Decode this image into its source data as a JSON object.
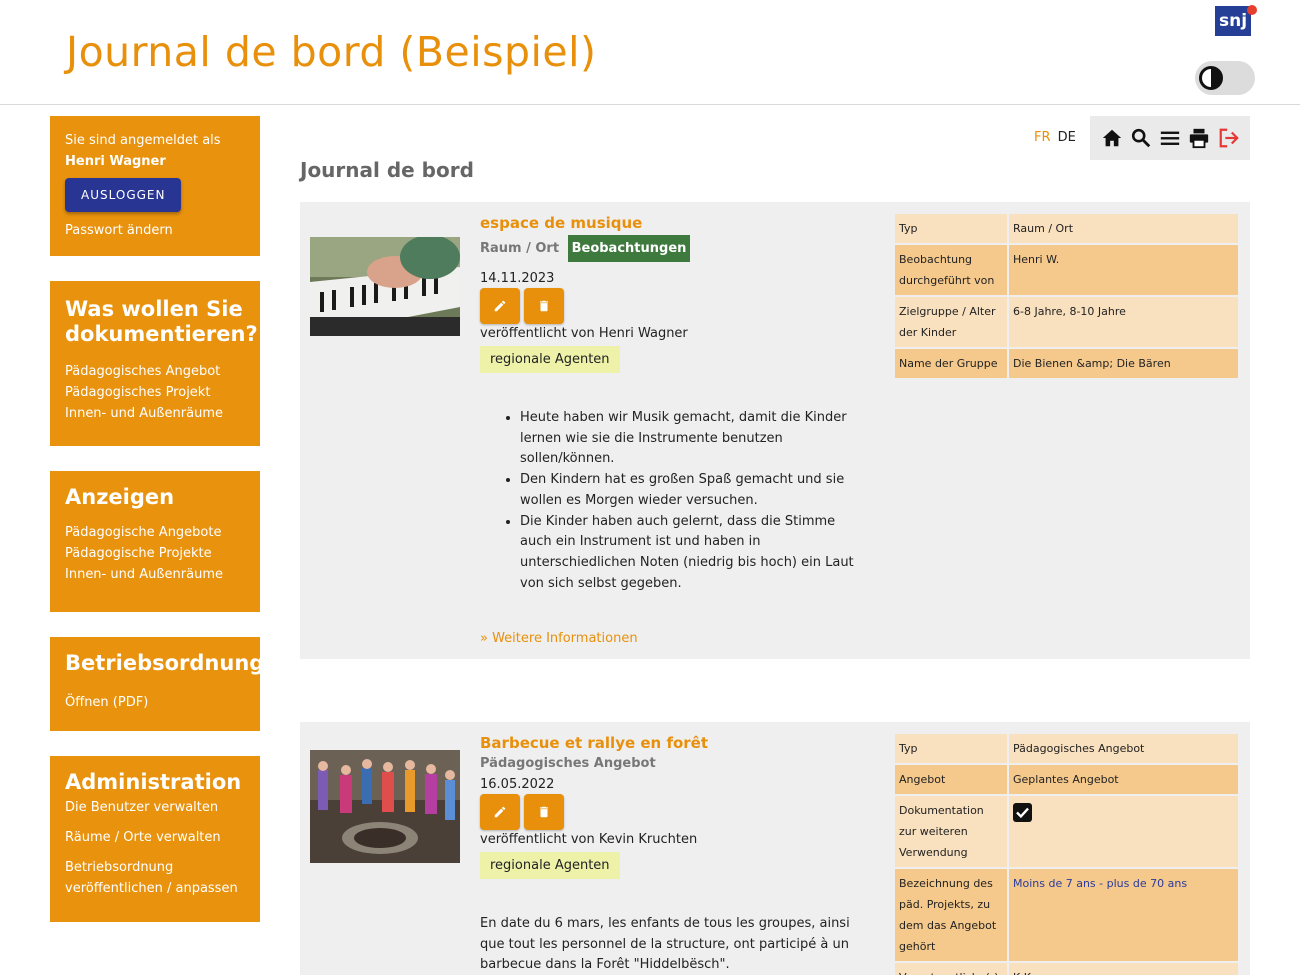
{
  "header": {
    "title": "Journal de bord (Beispiel)",
    "logo_text": "snj"
  },
  "sidebar": {
    "login": {
      "logged_in_as": "Sie sind angemeldet als",
      "user_name": "Henri Wagner",
      "logout_label": "AUSLOGGEN",
      "change_password": "Passwort ändern"
    },
    "document": {
      "heading": "Was wollen Sie dokumentieren?",
      "links": [
        "Pädagogisches Angebot",
        "Pädagogisches Projekt",
        "Innen- und Außenräume"
      ]
    },
    "show": {
      "heading": "Anzeigen",
      "links": [
        "Pädagogische Angebote",
        "Pädagogische Projekte",
        "Innen- und Außenräume"
      ]
    },
    "rules": {
      "heading": "Betriebsordnung",
      "links": [
        "Öffnen (PDF)"
      ]
    },
    "admin": {
      "heading": "Administration",
      "links": [
        "Die Benutzer verwalten",
        "Räume / Orte verwalten",
        "Betriebsordnung veröffentlichen / anpassen"
      ]
    }
  },
  "toolbar": {
    "lang_fr": "FR",
    "lang_de": "DE",
    "icons": [
      "home-icon",
      "search-icon",
      "menu-icon",
      "print-icon",
      "logout-icon"
    ]
  },
  "main": {
    "page_title": "Journal de bord",
    "entries": [
      {
        "title": "espace de musique",
        "category": "Raum / Ort",
        "badge": "Beobachtungen",
        "date": "14.11.2023",
        "author": "veröffentlicht von Henri Wagner",
        "agent": "regionale Agenten",
        "bullets": [
          "Heute haben wir Musik gemacht, damit die Kinder lernen wie sie die Instrumente benutzen sollen/können.",
          "Den Kindern hat es großen Spaß gemacht und sie wollen es Morgen wieder versuchen.",
          "Die Kinder haben auch gelernt, dass die Stimme auch ein Instrument ist und haben in unterschiedlichen Noten (niedrig bis hoch) ein Laut von sich selbst gegeben."
        ],
        "more": "» Weitere Informationen",
        "table": [
          {
            "key": "Typ",
            "value": "Raum / Ort"
          },
          {
            "key": "Beobachtung durchgeführt von",
            "value": "Henri W."
          },
          {
            "key": "Zielgruppe / Alter der Kinder",
            "value": "6-8 Jahre, 8-10 Jahre"
          },
          {
            "key": "Name der Gruppe",
            "value": "Die Bienen &amp; Die Bären"
          }
        ]
      },
      {
        "title": "Barbecue et rallye en forêt",
        "category": "Pädagogisches Angebot",
        "date": "16.05.2022",
        "author": "veröffentlicht von Kevin Kruchten",
        "agent": "regionale Agenten",
        "text": "En date du 6 mars, les enfants de tous les groupes, ainsi que tout les personnel de la structure, ont participé à un barbecue dans la Forêt \"Hiddelbësch\".",
        "table": [
          {
            "key": "Typ",
            "value": "Pädagogisches Angebot"
          },
          {
            "key": "Angebot",
            "value": "Geplantes Angebot"
          },
          {
            "key": "Dokumentation zur weiteren Verwendung",
            "value": ""
          },
          {
            "key": "Bezeichnung des päd. Projekts, zu dem das Angebot gehört",
            "value": "Moins de 7 ans - plus de 70 ans"
          },
          {
            "key": "Verantwortliche(r)",
            "value": "K.K."
          }
        ]
      }
    ]
  },
  "colors": {
    "accent": "#e8900c",
    "sidebar_bg": "#e8920e",
    "logout_button": "#283593",
    "observation_badge": "#3e7a3e",
    "agent_badge": "#eef2a9"
  }
}
